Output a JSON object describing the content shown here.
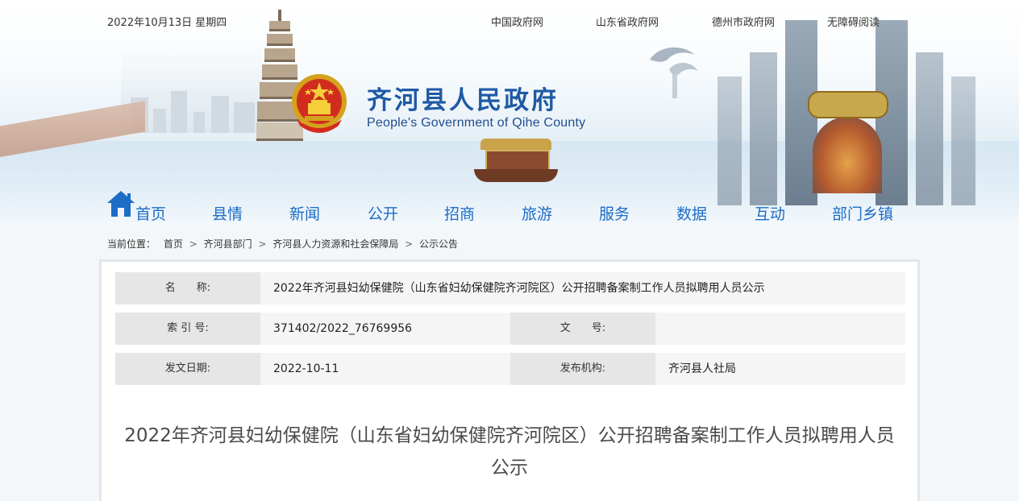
{
  "topbar": {
    "date": "2022年10月13日 星期四",
    "links": [
      "中国政府网",
      "山东省政府网",
      "德州市政府网",
      "无障碍阅读"
    ]
  },
  "header": {
    "title": "齐河县人民政府",
    "subtitle": "People's Government of Qihe County"
  },
  "nav": {
    "items": [
      "首页",
      "县情",
      "新闻",
      "公开",
      "招商",
      "旅游",
      "服务",
      "数据",
      "互动",
      "部门乡镇"
    ]
  },
  "breadcrumb": {
    "prefix": "当前位置：",
    "items": [
      "首页",
      "齐河县部门",
      "齐河县人力资源和社会保障局",
      "公示公告"
    ],
    "separator": ">"
  },
  "meta": {
    "name_label": "名　　称:",
    "name_value": "2022年齐河县妇幼保健院（山东省妇幼保健院齐河院区）公开招聘备案制工作人员拟聘用人员公示",
    "index_label": "索 引 号:",
    "index_value": "371402/2022_76769956",
    "docno_label": "文　　号:",
    "docno_value": "",
    "date_label": "发文日期:",
    "date_value": "2022-10-11",
    "org_label": "发布机构:",
    "org_value": "齐河县人社局"
  },
  "article": {
    "title_line1": "2022年齐河县妇幼保健院（山东省妇幼保健院齐河院区）公开招聘备案制工作人员拟聘用人员",
    "title_line2": "公示"
  },
  "colors": {
    "title_blue": "#1f5aa4",
    "nav_blue": "#1d6cc8",
    "label_gray": "#e6e6e6",
    "value_gray": "#f5f5f5"
  }
}
